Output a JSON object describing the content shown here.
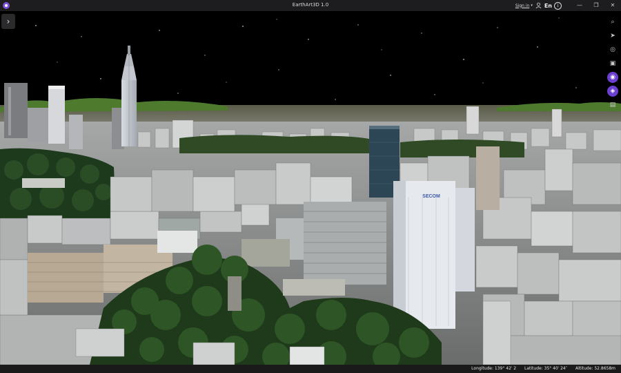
{
  "window": {
    "title": "EarthArt3D 1.0"
  },
  "titlebar": {
    "sign_in": "Sign in",
    "language": "En",
    "info": "i",
    "minimize": "—",
    "restore": "❐",
    "close": "✕"
  },
  "panel_toggle": {
    "glyph": "›"
  },
  "toolbar": {
    "tools": [
      {
        "name": "search",
        "glyph": "⌕"
      },
      {
        "name": "cursor",
        "glyph": "➤"
      },
      {
        "name": "target",
        "glyph": "◎"
      },
      {
        "name": "screenshot",
        "glyph": "▣"
      },
      {
        "name": "orbit",
        "glyph": "◉"
      },
      {
        "name": "wifi",
        "glyph": "◈"
      },
      {
        "name": "print",
        "glyph": "▤"
      }
    ]
  },
  "status": {
    "longitude": "Longitude: 139° 42′ 2",
    "latitude": "Latitude: 35° 40′ 24″",
    "altitude": "Altitude: 52.8658m"
  },
  "scene_labels": {
    "building_sign": "SECOM"
  },
  "colors": {
    "accent": "#6b3fcf",
    "sky": "#000000",
    "titlebar": "#1d1d1f"
  }
}
